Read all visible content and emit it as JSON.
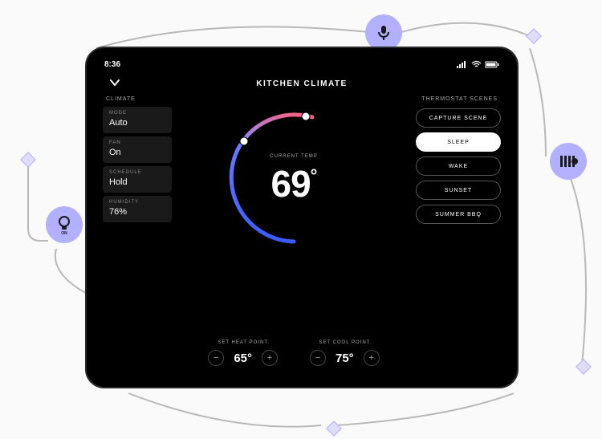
{
  "statusbar": {
    "time": "8:36"
  },
  "header": {
    "title": "KITCHEN CLIMATE"
  },
  "sidebar": {
    "title": "CLIMATE",
    "cards": [
      {
        "label": "MODE",
        "value": "Auto"
      },
      {
        "label": "FAN",
        "value": "On"
      },
      {
        "label": "SCHEDULE",
        "value": "Hold"
      },
      {
        "label": "HUMIDITY",
        "value": "76%"
      }
    ]
  },
  "dial": {
    "current_label": "CURRENT TEMP",
    "current_value": "69",
    "degree": "°"
  },
  "setpoints": {
    "heat": {
      "label": "SET HEAT POINT",
      "value": "65°"
    },
    "cool": {
      "label": "SET COOL POINT",
      "value": "75°"
    }
  },
  "scenes": {
    "title": "THERMOSTAT SCENES",
    "items": [
      "CAPTURE SCENE",
      "SLEEP",
      "WAKE",
      "SUNSET",
      "SUMMER BBQ"
    ],
    "active_index": 1
  },
  "decor": {
    "bulb_caption": "ON"
  }
}
